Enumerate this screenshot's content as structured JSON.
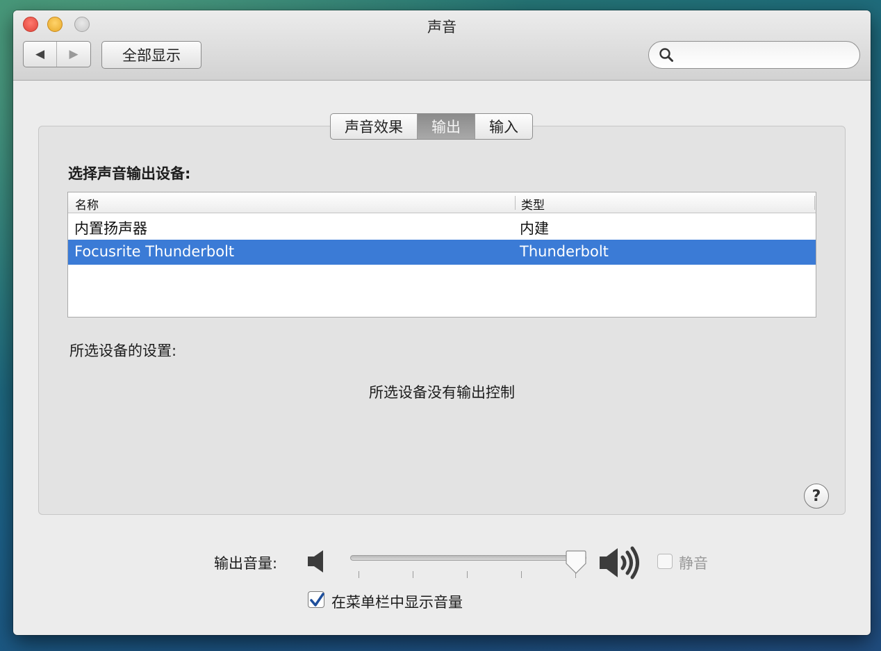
{
  "window": {
    "title": "声音"
  },
  "toolbar": {
    "back_icon": "◀",
    "forward_icon": "▶",
    "show_all_label": "全部显示",
    "search": {
      "value": "",
      "placeholder": ""
    }
  },
  "tabs": [
    {
      "label": "声音效果",
      "active": false
    },
    {
      "label": "输出",
      "active": true
    },
    {
      "label": "输入",
      "active": false
    }
  ],
  "output": {
    "select_label": "选择声音输出设备:",
    "columns": {
      "name": "名称",
      "type": "类型"
    },
    "devices": [
      {
        "name": "内置扬声器",
        "type": "内建",
        "selected": false
      },
      {
        "name": "Focusrite Thunderbolt",
        "type": "Thunderbolt",
        "selected": true
      }
    ],
    "settings_label": "所选设备的设置:",
    "no_control_message": "所选设备没有输出控制",
    "help_label": "?"
  },
  "volume": {
    "label": "输出音量:",
    "level": 1.0,
    "mute_label": "静音",
    "mute_checked": false,
    "mute_enabled": false
  },
  "menu_bar_option": {
    "label": "在菜单栏中显示音量",
    "checked": true
  },
  "colors": {
    "selection": "#3b7bd6",
    "close": "#e0443a",
    "minimize": "#e7a92a",
    "zoom": "#c9c9c9"
  }
}
